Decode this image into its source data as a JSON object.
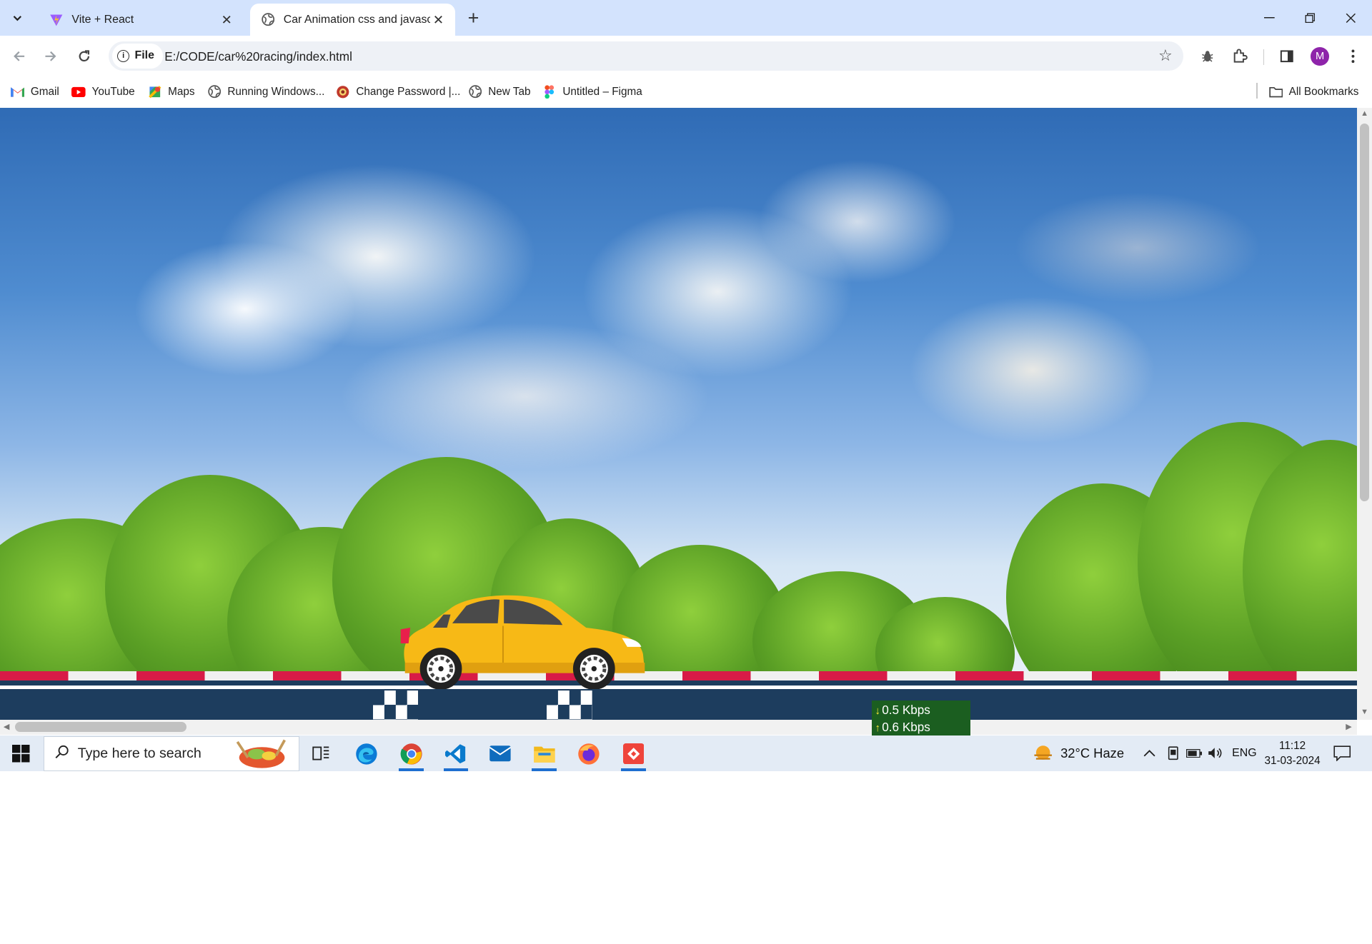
{
  "browser": {
    "tabs": [
      {
        "title": "Vite + React",
        "favicon": "vite-icon"
      },
      {
        "title": "Car Animation css and javascrip",
        "favicon": "globe-icon"
      }
    ],
    "url_chip": "File",
    "url": "E:/CODE/car%20racing/index.html",
    "avatar_letter": "M"
  },
  "bookmarks": [
    {
      "label": "Gmail",
      "icon": "gmail-icon"
    },
    {
      "label": "YouTube",
      "icon": "youtube-icon"
    },
    {
      "label": "Maps",
      "icon": "maps-icon"
    },
    {
      "label": "Running Windows...",
      "icon": "globe-icon"
    },
    {
      "label": "Change Password |...",
      "icon": "lock-badge-icon"
    },
    {
      "label": "New Tab",
      "icon": "globe-icon"
    },
    {
      "label": "Untitled – Figma",
      "icon": "figma-icon"
    }
  ],
  "all_bookmarks_label": "All Bookmarks",
  "netspeed": {
    "down": "0.5 Kbps",
    "up": "0.6 Kbps"
  },
  "taskbar": {
    "search_placeholder": "Type here to search",
    "weather": "32°C  Haze",
    "language": "ENG",
    "time": "11:12",
    "date": "31-03-2024"
  },
  "colors": {
    "tabstrip": "#d3e3fd",
    "road": "#1d3d5e",
    "road_stripe": "#d81b47",
    "car": "#f7b916"
  }
}
